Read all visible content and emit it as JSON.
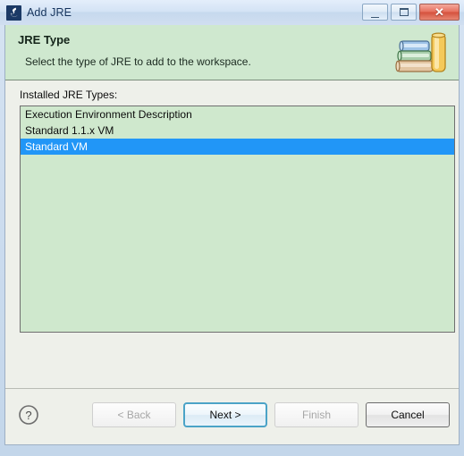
{
  "window": {
    "title": "Add JRE",
    "icon": "jre-wizard-icon",
    "controls": {
      "minimize": "minimize-icon",
      "maximize": "maximize-icon",
      "close": "close-icon",
      "close_glyph": "✕"
    }
  },
  "header": {
    "title": "JRE Type",
    "description": "Select the type of JRE to add to the workspace.",
    "icon": "books-stack-icon",
    "background": "#cfe8cf"
  },
  "body": {
    "list_label": "Installed JRE Types:",
    "list": {
      "items": [
        {
          "label": "Execution Environment Description",
          "selected": false
        },
        {
          "label": "Standard 1.1.x VM",
          "selected": false
        },
        {
          "label": "Standard VM",
          "selected": true
        }
      ],
      "background": "#cfe8cd",
      "selection_color": "#2196f7"
    }
  },
  "footer": {
    "help_icon": "help-question-icon",
    "buttons": [
      {
        "label": "< Back",
        "state": "disabled",
        "name": "back-button"
      },
      {
        "label": "Next >",
        "state": "default",
        "name": "next-button"
      },
      {
        "label": "Finish",
        "state": "disabled",
        "name": "finish-button"
      },
      {
        "label": "Cancel",
        "state": "enabled",
        "name": "cancel-button"
      }
    ]
  }
}
